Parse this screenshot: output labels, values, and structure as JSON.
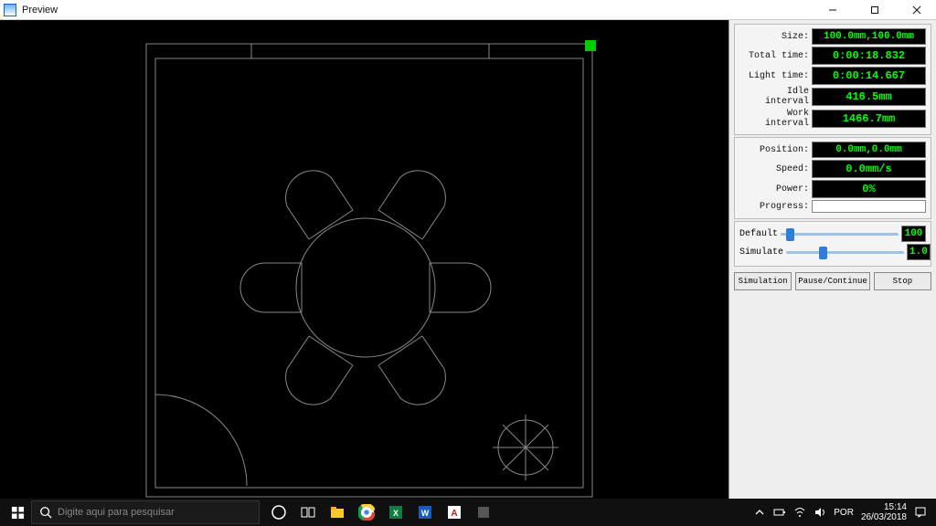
{
  "window": {
    "title": "Preview"
  },
  "stats": {
    "size_label": "Size:",
    "size_value": "100.0mm,100.0mm",
    "total_time_label": "Total time:",
    "total_time_value": "0:00:18.832",
    "light_time_label": "Light time:",
    "light_time_value": "0:00:14.667",
    "idle_interval_label": "Idle interval",
    "idle_interval_value": "416.5mm",
    "work_interval_label": "Work interval",
    "work_interval_value": "1466.7mm"
  },
  "runtime": {
    "position_label": "Position:",
    "position_value": "0.0mm,0.0mm",
    "speed_label": "Speed:",
    "speed_value": "0.0mm/s",
    "power_label": "Power:",
    "power_value": "0%",
    "progress_label": "Progress:"
  },
  "sliders": {
    "default_label": "Default",
    "default_value": "100",
    "simulate_label": "Simulate",
    "simulate_value": "1.0"
  },
  "buttons": {
    "simulation": "Simulation",
    "pause_continue": "Pause/Continue",
    "stop": "Stop"
  },
  "taskbar": {
    "search_placeholder": "Digite aqui para pesquisar",
    "lang": "POR",
    "time": "15:14",
    "date": "26/03/2018"
  }
}
